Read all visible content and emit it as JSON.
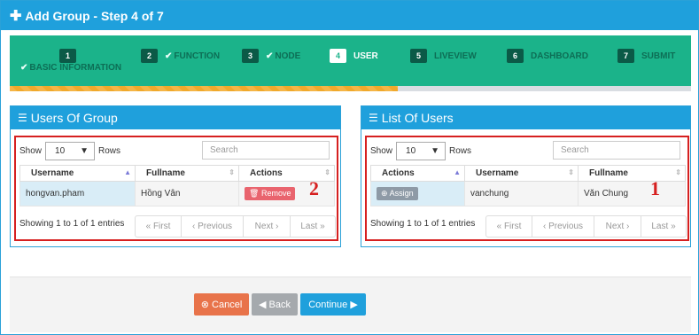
{
  "title": "Add Group - Step 4 of 7",
  "steps": [
    {
      "num": "1",
      "label": "BASIC INFORMATION",
      "done": true
    },
    {
      "num": "2",
      "label": "FUNCTION",
      "done": true
    },
    {
      "num": "3",
      "label": "NODE",
      "done": true
    },
    {
      "num": "4",
      "label": "USER",
      "active": true
    },
    {
      "num": "5",
      "label": "LIVEVIEW"
    },
    {
      "num": "6",
      "label": "DASHBOARD"
    },
    {
      "num": "7",
      "label": "SUBMIT"
    }
  ],
  "progress_fraction": 0.57,
  "users_of_group": {
    "title": "Users Of Group",
    "show_label": "Show",
    "rows_value": "10",
    "rows_label": "Rows",
    "search_placeholder": "Search",
    "columns": [
      "Username",
      "Fullname",
      "Actions"
    ],
    "rows": [
      {
        "username": "hongvan.pham",
        "fullname": "Hồng Vân",
        "action": "Remove"
      }
    ],
    "info": "Showing 1 to 1 of 1 entries",
    "pager": {
      "first": "First",
      "previous": "Previous",
      "next": "Next",
      "last": "Last"
    },
    "marker": "2"
  },
  "list_of_users": {
    "title": "List Of Users",
    "show_label": "Show",
    "rows_value": "10",
    "rows_label": "Rows",
    "search_placeholder": "Search",
    "columns": [
      "Actions",
      "Username",
      "Fullname"
    ],
    "rows": [
      {
        "action": "Assign",
        "username": "vanchung",
        "fullname": "Văn Chung"
      }
    ],
    "info": "Showing 1 to 1 of 1 entries",
    "pager": {
      "first": "First",
      "previous": "Previous",
      "next": "Next",
      "last": "Last"
    },
    "marker": "1"
  },
  "footer": {
    "cancel": "Cancel",
    "back": "Back",
    "continue": "Continue"
  },
  "colors": {
    "header": "#1fa0dc",
    "wizard": "#1bb38a",
    "cancel": "#e8734a",
    "back": "#a5a9ad",
    "continue": "#1fa0dc",
    "remove": "#e9646e",
    "assign": "#8e9aa6",
    "annotation": "#d62020"
  }
}
